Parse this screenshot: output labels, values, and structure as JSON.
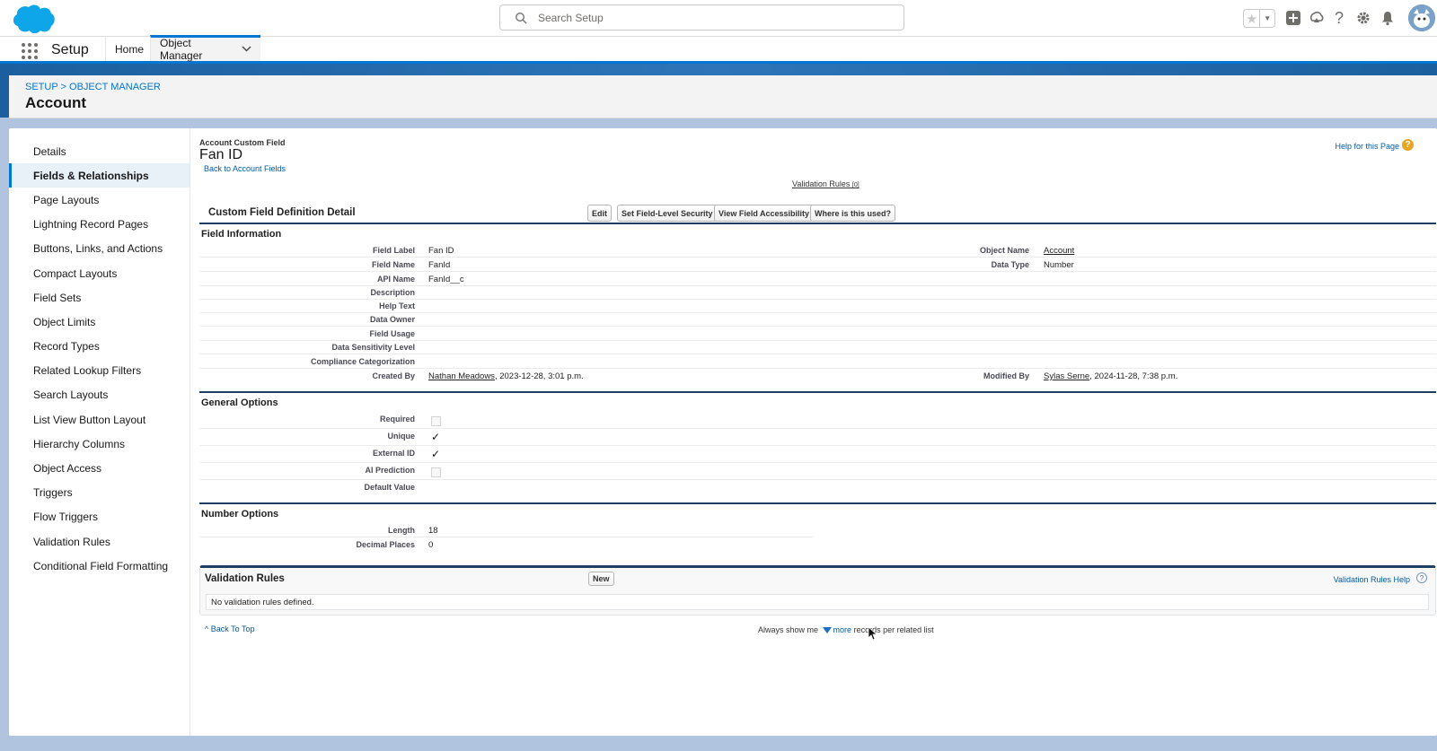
{
  "header": {
    "search_placeholder": "Search Setup"
  },
  "context_bar": {
    "app_name": "Setup",
    "tabs": [
      {
        "label": "Home"
      },
      {
        "label": "Object Manager"
      }
    ]
  },
  "page_header": {
    "breadcrumb": "SETUP > OBJECT MANAGER",
    "title": "Account"
  },
  "sidebar": {
    "items": [
      {
        "label": "Details"
      },
      {
        "label": "Fields & Relationships"
      },
      {
        "label": "Page Layouts"
      },
      {
        "label": "Lightning Record Pages"
      },
      {
        "label": "Buttons, Links, and Actions"
      },
      {
        "label": "Compact Layouts"
      },
      {
        "label": "Field Sets"
      },
      {
        "label": "Object Limits"
      },
      {
        "label": "Record Types"
      },
      {
        "label": "Related Lookup Filters"
      },
      {
        "label": "Search Layouts"
      },
      {
        "label": "List View Button Layout"
      },
      {
        "label": "Hierarchy Columns"
      },
      {
        "label": "Object Access"
      },
      {
        "label": "Triggers"
      },
      {
        "label": "Flow Triggers"
      },
      {
        "label": "Validation Rules"
      },
      {
        "label": "Conditional Field Formatting"
      }
    ]
  },
  "content": {
    "field_type": "Account Custom Field",
    "field_title": "Fan ID",
    "back_link": "Back to Account Fields",
    "help_link": "Help for this Page",
    "related_link": "Validation Rules",
    "related_count": "[0]",
    "detail_title": "Custom Field Definition Detail",
    "buttons": {
      "edit": "Edit",
      "fls": "Set Field-Level Security",
      "accessibility": "View Field Accessibility",
      "where_used": "Where is this used?"
    },
    "field_info": {
      "section_title": "Field Information",
      "field_label_lbl": "Field Label",
      "field_label_val": "Fan ID",
      "object_name_lbl": "Object Name",
      "object_name_val": "Account",
      "field_name_lbl": "Field Name",
      "field_name_val": "FanId",
      "data_type_lbl": "Data Type",
      "data_type_val": "Number",
      "api_name_lbl": "API Name",
      "api_name_val": "FanId__c",
      "description_lbl": "Description",
      "help_text_lbl": "Help Text",
      "data_owner_lbl": "Data Owner",
      "field_usage_lbl": "Field Usage",
      "sensitivity_lbl": "Data Sensitivity Level",
      "compliance_lbl": "Compliance Categorization",
      "created_by_lbl": "Created By",
      "created_by_user": "Nathan Meadows",
      "created_by_date": ", 2023-12-28, 3:01 p.m.",
      "modified_by_lbl": "Modified By",
      "modified_by_user": "Sylas Serne",
      "modified_by_date": ", 2024-11-28, 7:38 p.m."
    },
    "general_options": {
      "section_title": "General Options",
      "required_lbl": "Required",
      "required": false,
      "unique_lbl": "Unique",
      "unique": true,
      "external_id_lbl": "External ID",
      "external_id": true,
      "ai_prediction_lbl": "AI Prediction",
      "ai_prediction": false,
      "default_value_lbl": "Default Value"
    },
    "number_options": {
      "section_title": "Number Options",
      "length_lbl": "Length",
      "length_val": "18",
      "decimal_lbl": "Decimal Places",
      "decimal_val": "0"
    },
    "validation_rules": {
      "title": "Validation Rules",
      "new_button": "New",
      "help_link": "Validation Rules Help",
      "empty_text": "No validation rules defined."
    },
    "footer": {
      "back_to_top": "Back To Top",
      "always_show_pre": "Always show me",
      "more": "more",
      "always_show_post": "records per related list"
    }
  }
}
